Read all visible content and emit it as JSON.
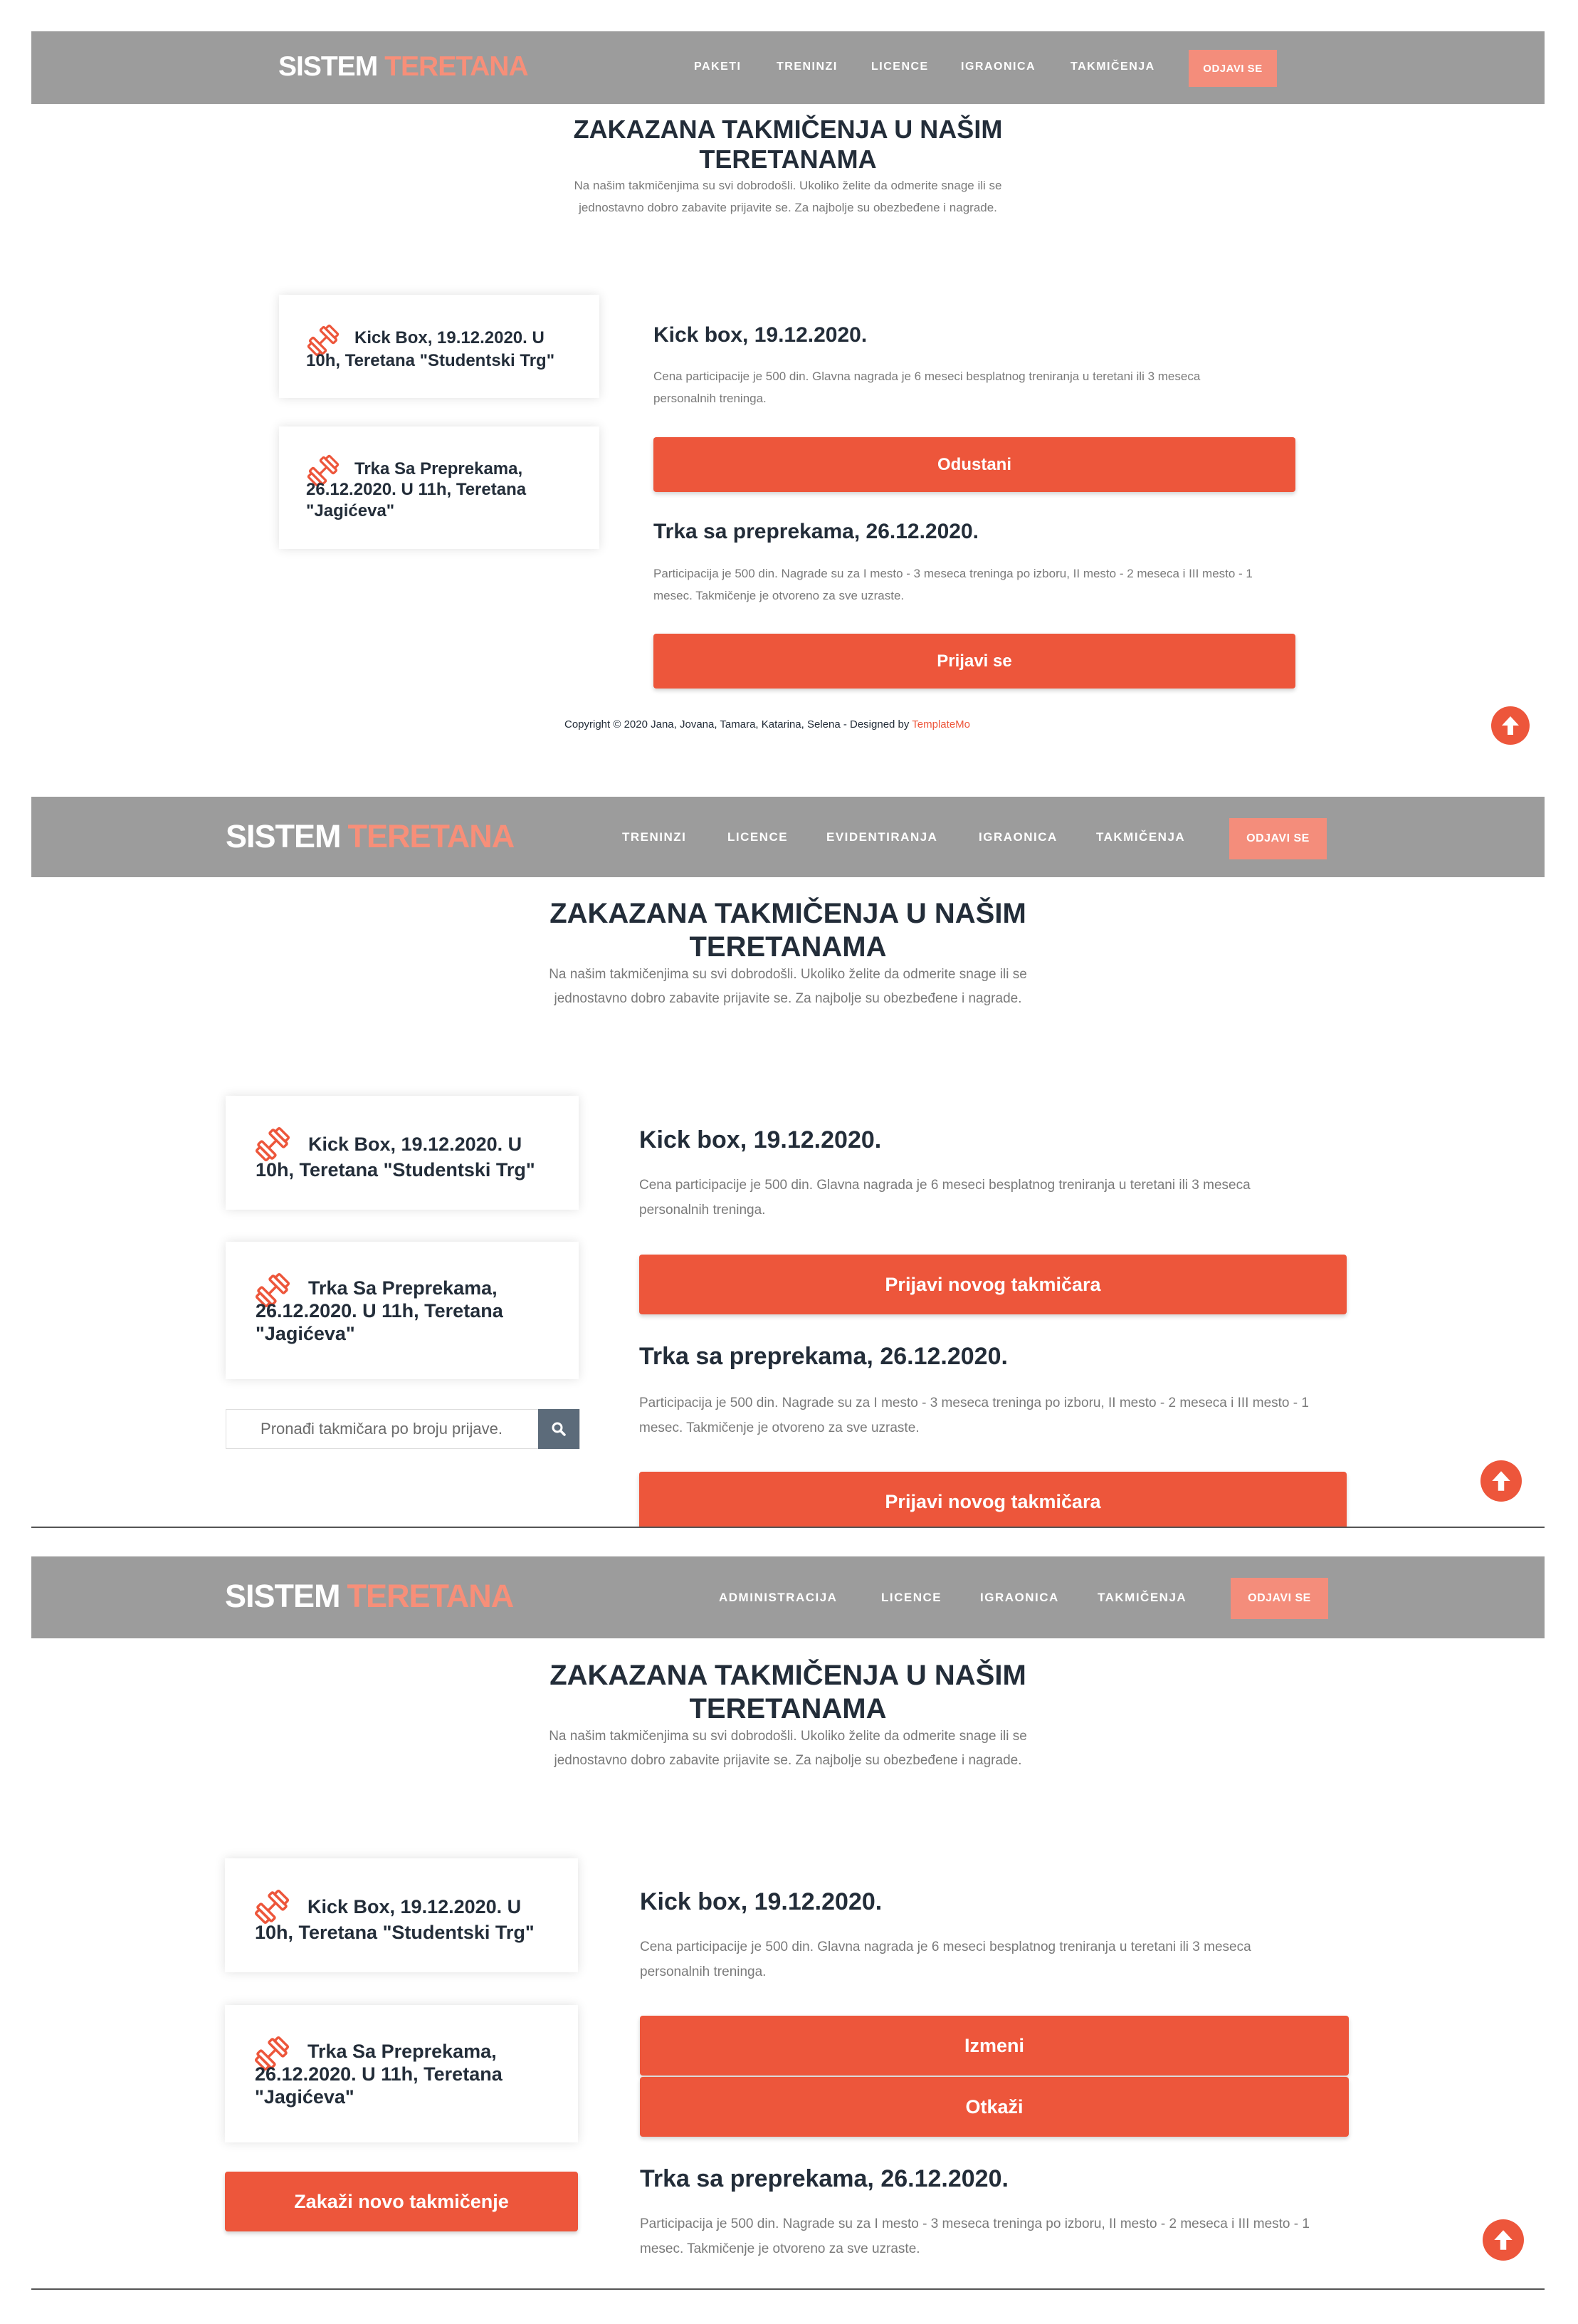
{
  "colors": {
    "accent": "#ed563b",
    "nav_bg": "#9c9c9c",
    "logo_accent": "#f78f79",
    "heading": "#232d39"
  },
  "logo": {
    "main": "SISTEM",
    "accent": "TERETANA"
  },
  "heading": {
    "title_line1": "ZAKAZANA TAKMIČENJA U NAŠIM",
    "title_line2": "TERETANAMA",
    "subtitle_line1": "Na našim takmičenjima su svi dobrodošli. Ukoliko želite da odmerite snage ili se",
    "subtitle_line2": "jednostavno dobro zabavite prijavite se. Za najbolje su obezbeđene i nagrade."
  },
  "cards": {
    "kickbox": {
      "line1": "Kick Box, 19.12.2020. U",
      "line2": "10h, Teretana \"Studentski Trg\""
    },
    "trka": {
      "line1": "Trka Sa Preprekama,",
      "line2": "26.12.2020. U 11h, Teretana",
      "line3": "\"Jagićeva\""
    }
  },
  "events": {
    "kickbox": {
      "title": "Kick box, 19.12.2020.",
      "desc_line1": "Cena participacije je 500 din. Glavna nagrada je 6 meseci besplatnog treniranja u teretani ili 3 meseca",
      "desc_line2": "personalnih treninga."
    },
    "trka": {
      "title": "Trka sa preprekama, 26.12.2020.",
      "desc_line1": "Participacija je 500 din. Nagrade su za I mesto - 3 meseca treninga po izboru, II mesto - 2 meseca i III mesto - 1",
      "desc_line2": "mesec. Takmičenje je otvoreno za sve uzraste."
    }
  },
  "screens": {
    "member": {
      "nav": [
        "PAKETI",
        "TRENINZI",
        "LICENCE",
        "IGRAONICA",
        "TAKMIČENJA"
      ],
      "logout": "ODJAVI SE",
      "btn_kickbox": "Odustani",
      "btn_trka": "Prijavi se",
      "copyright": "Copyright © 2020 Jana, Jovana, Tamara, Katarina, Selena - Designed by ",
      "copyright_link": "TemplateMo"
    },
    "staff": {
      "nav": [
        "TRENINZI",
        "LICENCE",
        "EVIDENTIRANJA",
        "IGRAONICA",
        "TAKMIČENJA"
      ],
      "logout": "ODJAVI SE",
      "search_placeholder": "Pronađi takmičara po broju prijave.",
      "btn_kickbox": "Prijavi novog takmičara",
      "btn_trka": "Prijavi novog takmičara"
    },
    "admin": {
      "nav": [
        "ADMINISTRACIJA",
        "LICENCE",
        "IGRAONICA",
        "TAKMIČENJA"
      ],
      "logout": "ODJAVI SE",
      "btn_edit": "Izmeni",
      "btn_cancel": "Otkaži",
      "btn_schedule": "Zakaži novo takmičenje"
    }
  },
  "icons": {
    "dumbbell": "dumbbell-icon",
    "search": "search-icon",
    "scroll_top": "arrow-up-circle-icon"
  }
}
